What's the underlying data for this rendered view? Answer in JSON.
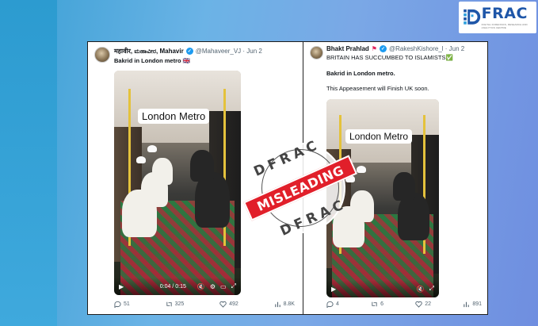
{
  "brand": {
    "name": "FRAC",
    "tagline": "DIGITAL FORENSICS, RESEARCH AND ANALYTICS CENTRE"
  },
  "tweets": [
    {
      "display_name": "महावीर, ಮಹಾವೀರ, Mahavir",
      "handle_date": "@Mahaveer_VJ · Jun 2",
      "text_lines": [
        "Bakrid in London metro 🇬🇧"
      ],
      "video_label": "London Metro",
      "video_time": "0:04 / 0:15",
      "stats": {
        "replies": "51",
        "reposts": "325",
        "likes": "492",
        "views": "8.8K"
      }
    },
    {
      "display_name": "Bhakt Prahlad",
      "handle_date": "@RakeshKishore_l · Jun 2",
      "text_lines": [
        "BRITAIN HAS SUCCUMBED TO ISLAMISTS✅",
        "Bakrid in London metro.",
        "This Appeasement will Finish UK soon."
      ],
      "video_label": "London Metro",
      "video_time": "",
      "stats": {
        "replies": "4",
        "reposts": "6",
        "likes": "22",
        "views": "891"
      }
    }
  ],
  "stamp": {
    "top_text": "DFRAC",
    "banner": "MISLEADING",
    "bottom_text": "DFRAC"
  },
  "colors": {
    "verified": "#1d9bf0",
    "stamp_red": "#e11f2a",
    "brand_blue": "#1e56a8"
  }
}
